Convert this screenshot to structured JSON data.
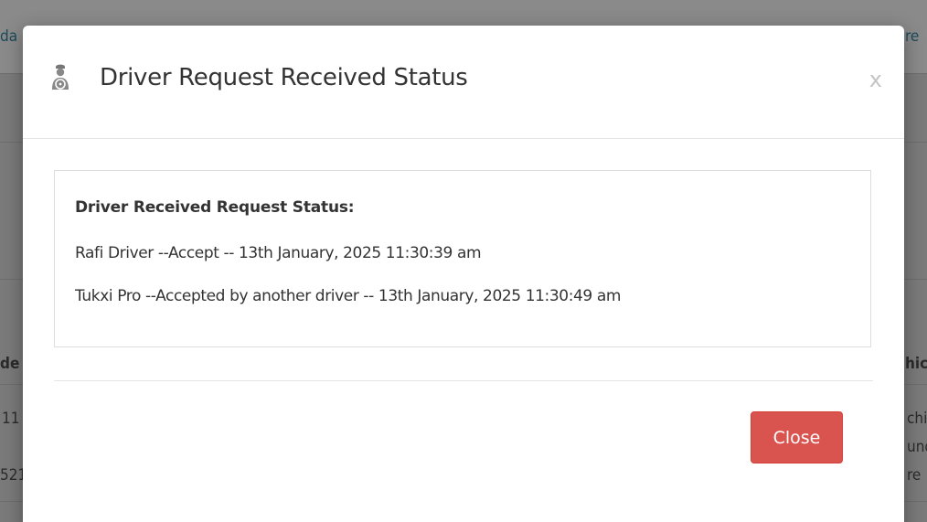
{
  "background": {
    "fragments": {
      "top_left": "da",
      "top_right": "re",
      "mid_left": "de",
      "mid_right": "hic",
      "row_left_1": "11",
      "row_left_2": "521",
      "row_right_1": "chi",
      "row_right_2": "und",
      "row_right_3": "re"
    }
  },
  "modal": {
    "title": "Driver Request Received Status",
    "close_x": "x",
    "body": {
      "heading": "Driver Received Request Status:",
      "lines": [
        "Rafi Driver --Accept -- 13th January, 2025 11:30:39 am",
        "Tukxi Pro --Accepted by another driver -- 13th January, 2025 11:30:49 am"
      ]
    },
    "footer": {
      "close_label": "Close"
    }
  },
  "colors": {
    "overlay": "#7a7a7a",
    "danger": "#d9534f",
    "title_text": "#333333"
  },
  "icons": {
    "title_icon": "driver-icon"
  }
}
